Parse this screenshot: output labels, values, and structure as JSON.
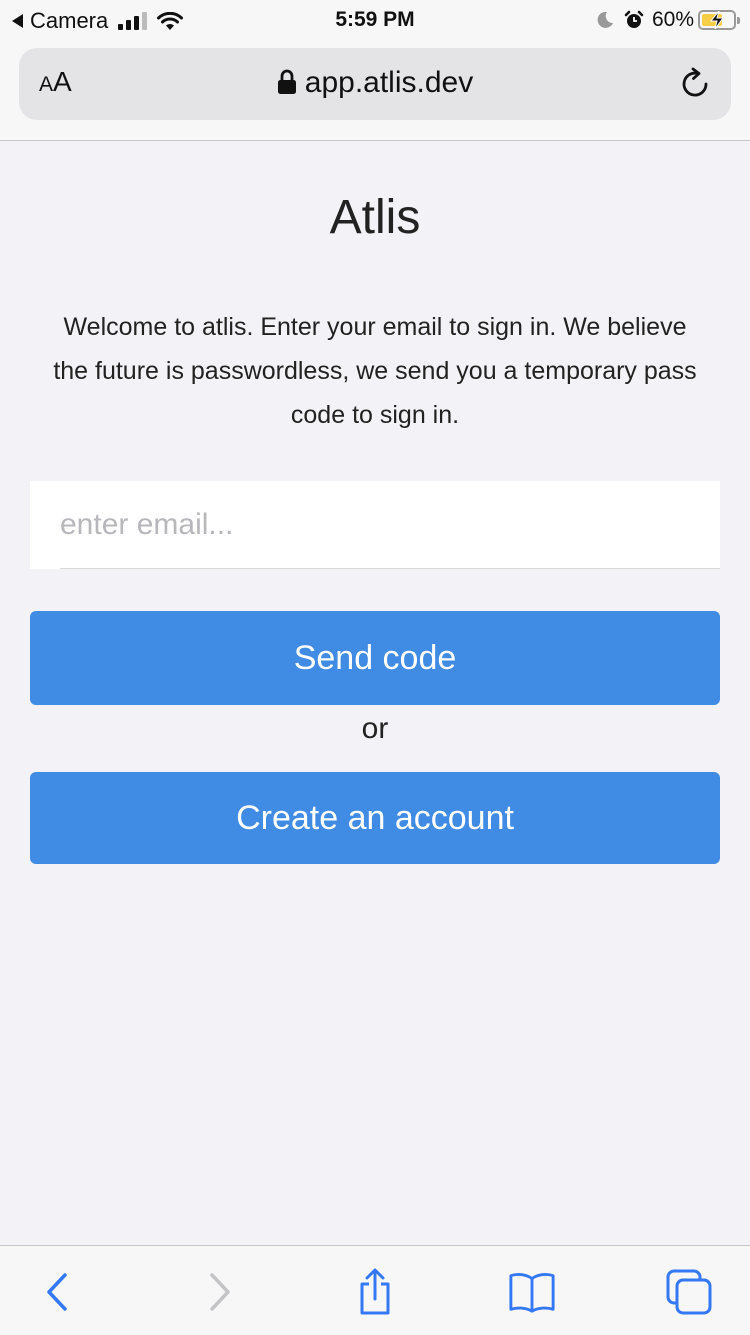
{
  "status_bar": {
    "back_app": "Camera",
    "time": "5:59 PM",
    "battery": "60%"
  },
  "address_bar": {
    "text_size_button": "AA",
    "url": "app.atlis.dev"
  },
  "page": {
    "title": "Atlis",
    "welcome": "Welcome to atlis. Enter your email to sign in. We believe the future is passwordless, we send you a temporary pass code to sign in.",
    "email_placeholder": "enter email...",
    "email_value": "",
    "send_code_label": "Send code",
    "or_label": "or",
    "create_account_label": "Create an account"
  },
  "colors": {
    "primary_button": "#408be3",
    "page_background": "#f2f2f7",
    "toolbar_icon": "#3478f6"
  },
  "toolbar": {
    "icons": [
      "back-icon",
      "forward-icon",
      "share-icon",
      "bookmarks-icon",
      "tabs-icon"
    ]
  }
}
